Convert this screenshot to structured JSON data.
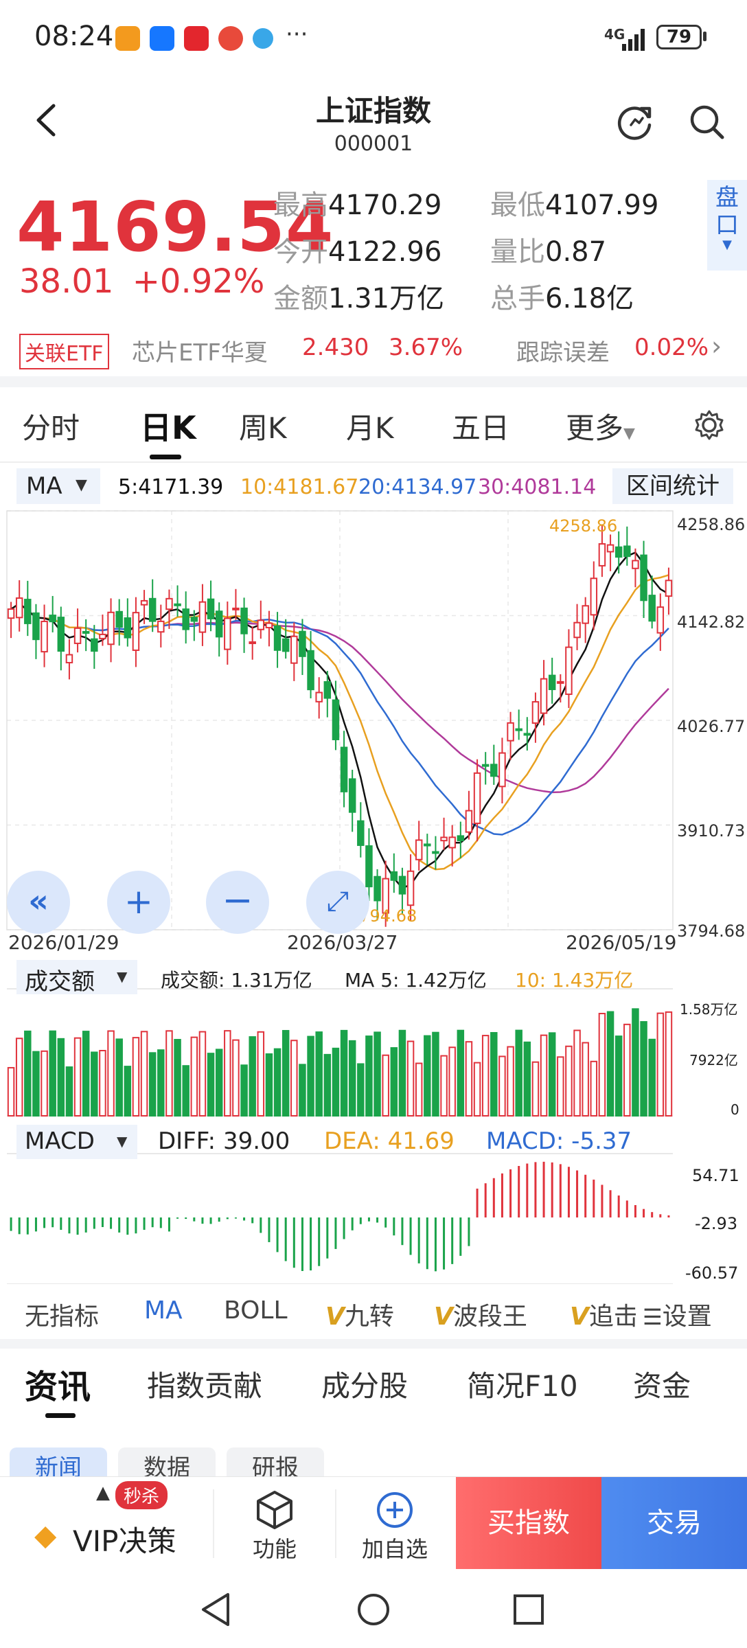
{
  "status_bar": {
    "time": "08:24",
    "more": "···",
    "network": "4G",
    "battery": "79"
  },
  "header": {
    "title": "上证指数",
    "code": "000001"
  },
  "quote": {
    "price": "4169.54",
    "change": "38.01",
    "change_pct": "+0.92%",
    "stats": [
      {
        "label": "最高",
        "value": "4170.29"
      },
      {
        "label": "最低",
        "value": "4107.99"
      },
      {
        "label": "今开",
        "value": "4122.96"
      },
      {
        "label": "量比",
        "value": "0.87"
      },
      {
        "label": "金额",
        "value": "1.31万亿"
      },
      {
        "label": "总手",
        "value": "6.18亿"
      }
    ],
    "pankou": "盘口"
  },
  "etf": {
    "tag": "关联ETF",
    "name": "芯片ETF华夏",
    "price": "2.430",
    "pct": "3.67%",
    "tracking_label": "跟踪误差",
    "tracking_value": "0.02%"
  },
  "period_tabs": [
    "分时",
    "日K",
    "周K",
    "月K",
    "五日",
    "更多"
  ],
  "active_period": "日K",
  "ma_bar": {
    "selector": "MA",
    "ma5": "5:4171.39",
    "ma10": "10:4181.67",
    "ma20": "20:4134.97",
    "ma30": "30:4081.14",
    "range_stats": "区间统计"
  },
  "colors": {
    "up": "#e0333c",
    "down": "#1aa34a",
    "ma5": "#111111",
    "ma10": "#e8a020",
    "ma20": "#2f6bd1",
    "ma30": "#b03a9a",
    "accent": "#2f6bd1"
  },
  "kline": {
    "y_ticks": [
      "4258.86",
      "4142.82",
      "4026.77",
      "3910.73",
      "3794.68"
    ],
    "x_ticks": [
      "2026/01/29",
      "2026/03/27",
      "2026/05/19"
    ],
    "high_label": "4258.86",
    "low_label": "3794.68"
  },
  "volume": {
    "selector": "成交额",
    "label": "成交额: 1.31万亿",
    "ma5": "MA 5: 1.42万亿",
    "ma10": "10: 1.43万亿",
    "y_ticks": [
      "1.58万亿",
      "7922亿",
      "0"
    ]
  },
  "macd": {
    "selector": "MACD",
    "diff": "DIFF: 39.00",
    "dea": "DEA: 41.69",
    "macd": "MACD: -5.37",
    "y_ticks": [
      "54.71",
      "-2.93",
      "-60.57"
    ]
  },
  "indicator_tabs": [
    "无指标",
    "MA",
    "BOLL",
    "九转",
    "波段王",
    "追击"
  ],
  "indicator_active": "MA",
  "indicator_settings": "设置",
  "news_tabs": [
    "资讯",
    "指数贡献",
    "成分股",
    "简况F10",
    "资金"
  ],
  "news_active": "资讯",
  "sub_tabs": [
    "新闻",
    "数据",
    "研报"
  ],
  "action_bar": {
    "flash_badge": "秒杀",
    "vip": "VIP决策",
    "function": "功能",
    "add_watch": "加自选",
    "buy_index": "买指数",
    "trade": "交易"
  }
}
